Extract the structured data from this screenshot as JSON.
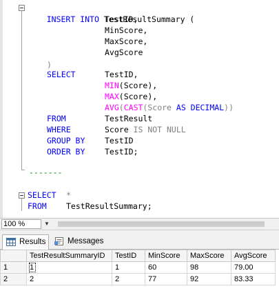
{
  "editor": {
    "lines": {
      "l1": {
        "kw": "INSERT INTO",
        "rest": " TestResultSummary ("
      },
      "l2": "TestID,",
      "l3": "MinScore,",
      "l4": "MaxScore,",
      "l5": "AvgScore",
      "l6": ")",
      "l7": {
        "kw": "SELECT",
        "rest": "TestID,"
      },
      "l8": {
        "fn": "MIN",
        "rest": "(Score),"
      },
      "l9": {
        "fn": "MAX",
        "rest": "(Score),"
      },
      "l10": {
        "fn1": "AVG",
        "p1": "(",
        "fn2": "CAST",
        "p2": "(Score ",
        "kw": "AS DECIMAL",
        "p3": "))"
      },
      "l11": {
        "kw": "FROM",
        "rest": "TestResult"
      },
      "l12": {
        "kw": "WHERE",
        "rest": "Score ",
        "gray": "IS NOT NULL"
      },
      "l13": {
        "kw": "GROUP BY",
        "rest": "TestID"
      },
      "l14": {
        "kw": "ORDER BY",
        "rest": "TestID;"
      },
      "l15": "-------",
      "l16": {
        "kw": "SELECT",
        "rest": "*"
      },
      "l17": {
        "kw": "FROM",
        "rest": "TestResultSummary;"
      }
    }
  },
  "zoom": {
    "value": "100 %",
    "arrow": "▼"
  },
  "tabs": {
    "results": "Results",
    "messages": "Messages"
  },
  "grid": {
    "columns": [
      "TestResultSummaryID",
      "TestID",
      "MinScore",
      "MaxScore",
      "AvgScore"
    ],
    "rows": [
      {
        "num": "1",
        "cells": [
          "1",
          "1",
          "60",
          "98",
          "79.00"
        ]
      },
      {
        "num": "2",
        "cells": [
          "2",
          "2",
          "77",
          "92",
          "83.33"
        ]
      }
    ]
  },
  "colors": {
    "keyword": "#0000ff",
    "function": "#ff00ff",
    "operator": "#808080",
    "comment": "#008000"
  }
}
